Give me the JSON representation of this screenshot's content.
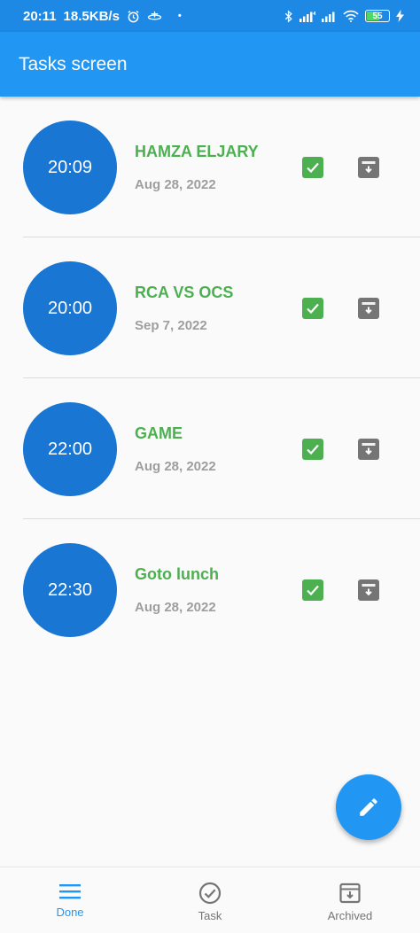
{
  "status_bar": {
    "time": "20:11",
    "speed": "18.5KB/s",
    "dot": "•",
    "battery": "55",
    "icons": [
      "alarm-icon",
      "airplane-icon",
      "bluetooth-icon",
      "signal-icon",
      "signal-icon",
      "wifi-icon",
      "battery-icon",
      "charging-icon"
    ]
  },
  "app_bar": {
    "title": "Tasks screen"
  },
  "tasks": [
    {
      "time": "20:09",
      "title": "HAMZA ELJARY",
      "date": "Aug 28, 2022"
    },
    {
      "time": "20:00",
      "title": "RCA VS OCS",
      "date": "Sep 7, 2022"
    },
    {
      "time": "22:00",
      "title": "GAME",
      "date": "Aug 28, 2022"
    },
    {
      "time": "22:30",
      "title": "Goto lunch",
      "date": "Aug 28, 2022"
    }
  ],
  "fab": {
    "icon": "edit-icon"
  },
  "bottom_nav": {
    "items": [
      {
        "label": "Done",
        "icon": "menu-icon",
        "active": true
      },
      {
        "label": "Task",
        "icon": "check-circle-icon",
        "active": false
      },
      {
        "label": "Archived",
        "icon": "archive-icon",
        "active": false
      }
    ]
  },
  "colors": {
    "primary": "#2196f3",
    "status_bar": "#1e88e5",
    "circle": "#1976d2",
    "title_green": "#4caf50",
    "date_grey": "#9e9e9e",
    "archive_grey": "#757575"
  }
}
